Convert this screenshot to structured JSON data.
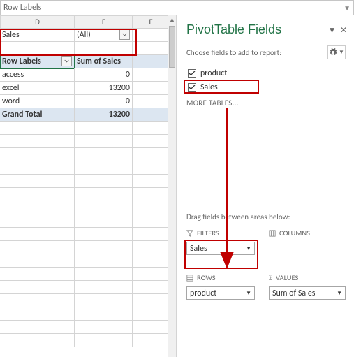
{
  "nameBox": "Row Labels",
  "columns": {
    "d": "D",
    "e": "E",
    "f": "F"
  },
  "filterRow": {
    "label": "Sales",
    "value": "(All)"
  },
  "pivot": {
    "hdr_d": "Row Labels",
    "hdr_e": "Sum of Sales",
    "rows": [
      {
        "label": "access",
        "value": "0"
      },
      {
        "label": "excel",
        "value": "13200"
      },
      {
        "label": "word",
        "value": "0"
      }
    ],
    "total_label": "Grand Total",
    "total_value": "13200"
  },
  "pane": {
    "title": "PivotTable Fields",
    "subtitle": "Choose fields to add to report:",
    "fields": [
      {
        "name": "product",
        "checked": true
      },
      {
        "name": "Sales",
        "checked": true
      }
    ],
    "more": "MORE TABLES...",
    "dragLabel": "Drag fields between areas below:",
    "areas": {
      "filters": {
        "label": "FILTERS",
        "items": [
          "Sales"
        ]
      },
      "columns": {
        "label": "COLUMNS",
        "items": []
      },
      "rows": {
        "label": "ROWS",
        "items": [
          "product"
        ]
      },
      "values": {
        "label": "VALUES",
        "items": [
          "Sum of Sales"
        ]
      }
    }
  }
}
